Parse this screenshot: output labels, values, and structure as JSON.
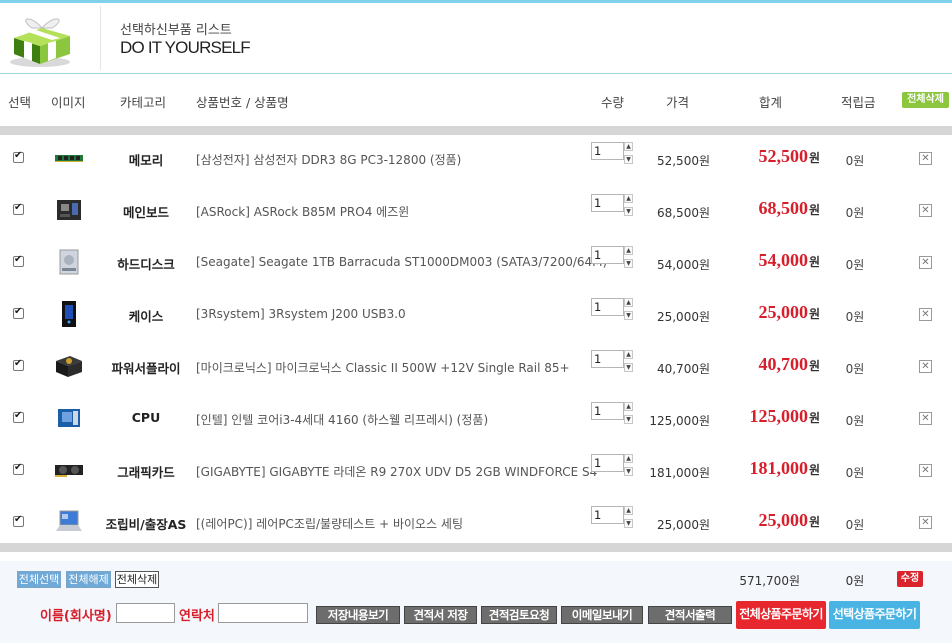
{
  "header": {
    "subtitle": "선택하신부품 리스트",
    "title": "DO IT YOURSELF"
  },
  "columns": {
    "select": "선택",
    "image": "이미지",
    "category": "카테고리",
    "product": "상품번호 / 상품명",
    "qty": "수량",
    "price": "가격",
    "total": "합계",
    "points": "적립금",
    "delete_all": "전체삭제"
  },
  "items": [
    {
      "category": "메모리",
      "name": "[삼성전자] 삼성전자 DDR3 8G PC3-12800 (정품)",
      "qty": "1",
      "price": "52,500원",
      "total": "52,500",
      "unit": "원",
      "points": "0원",
      "thumb": "memory-icon"
    },
    {
      "category": "메인보드",
      "name": "[ASRock] ASRock B85M PRO4 에즈윈",
      "qty": "1",
      "price": "68,500원",
      "total": "68,500",
      "unit": "원",
      "points": "0원",
      "thumb": "mainboard-icon"
    },
    {
      "category": "하드디스크",
      "name": "[Seagate] Seagate 1TB Barracuda ST1000DM003 (SATA3/7200/64M)",
      "qty": "1",
      "price": "54,000원",
      "total": "54,000",
      "unit": "원",
      "points": "0원",
      "thumb": "hdd-icon"
    },
    {
      "category": "케이스",
      "name": "[3Rsystem] 3Rsystem J200 USB3.0",
      "qty": "1",
      "price": "25,000원",
      "total": "25,000",
      "unit": "원",
      "points": "0원",
      "thumb": "case-icon"
    },
    {
      "category": "파워서플라이",
      "name": "[마이크로닉스] 마이크로닉스 Classic II 500W +12V Single Rail 85+",
      "qty": "1",
      "price": "40,700원",
      "total": "40,700",
      "unit": "원",
      "points": "0원",
      "thumb": "psu-icon"
    },
    {
      "category": "CPU",
      "name": "[인텔] 인텔 코어i3-4세대 4160 (하스웰 리프레시) (정품)",
      "qty": "1",
      "price": "125,000원",
      "total": "125,000",
      "unit": "원",
      "points": "0원",
      "thumb": "cpu-icon"
    },
    {
      "category": "그래픽카드",
      "name": "[GIGABYTE] GIGABYTE 라데온 R9 270X UDV D5 2GB WINDFORCE S4",
      "qty": "1",
      "price": "181,000원",
      "total": "181,000",
      "unit": "원",
      "points": "0원",
      "thumb": "gpu-icon"
    },
    {
      "category": "조립비/출장AS",
      "name": "[(레어PC)] 레어PC조립/불량테스트 + 바이오스 세팅",
      "qty": "1",
      "price": "25,000원",
      "total": "25,000",
      "unit": "원",
      "points": "0원",
      "thumb": "laptop-icon"
    }
  ],
  "footer": {
    "select_all": "전체선택",
    "deselect_all": "전체해제",
    "delete_all": "전체삭제",
    "sum_price": "571,700원",
    "sum_points": "0원",
    "edit": "수정",
    "name_label": "이름(회사명)",
    "contact_label": "연락처",
    "btn_view_saved": "저장내용보기",
    "btn_save_quote": "견적서 저장",
    "btn_review": "견적검토요청",
    "btn_email": "이메일보내기",
    "btn_print": "견적서출력",
    "btn_order_all": "전체상품주문하기",
    "btn_order_selected": "선택상품주문하기"
  },
  "colors": {
    "accent_red": "#d71f2c",
    "accent_green": "#8cc63f",
    "accent_blue": "#6fa9d8"
  }
}
